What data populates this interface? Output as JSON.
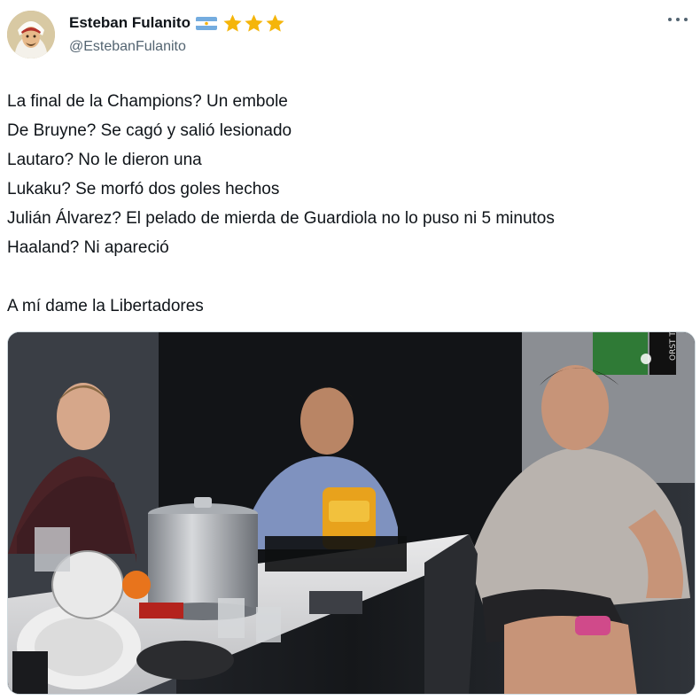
{
  "author": {
    "display_name": "Esteban Fulanito",
    "handle": "@EstebanFulanito",
    "flag": "argentina-flag-icon",
    "badges": [
      "star-icon",
      "star-icon",
      "star-icon"
    ],
    "star_color": "#f5b50a"
  },
  "tweet": {
    "lines": [
      "La final de la Champions? Un embole",
      "De Bruyne? Se cagó y salió lesionado",
      "Lautaro? No le dieron una",
      "Lukaku? Se morfó dos goles hechos",
      "Julián Álvarez? El pelado de mierda de Guardiola no lo puso ni 5 minutos",
      "Haaland? Ni apareció"
    ],
    "closing": "A mí dame la Libertadores"
  },
  "media": {
    "type": "video-still",
    "description_icon": "tv-screenshot",
    "overlay_text": "ORST TV"
  },
  "colors": {
    "text": "#0f1419",
    "secondary": "#536471"
  }
}
